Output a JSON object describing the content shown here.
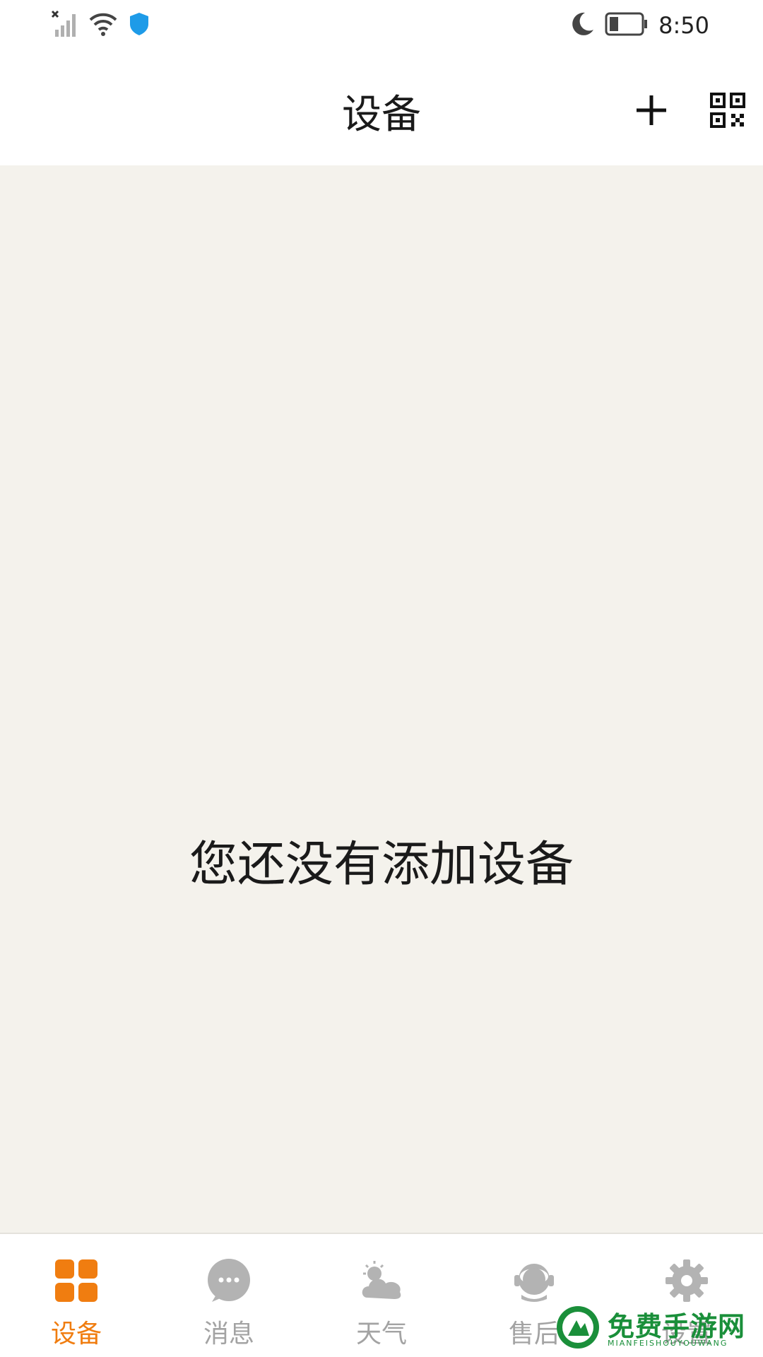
{
  "status_bar": {
    "time": "8:50",
    "icons": [
      "signal-off-icon",
      "wifi-icon",
      "shield-icon",
      "moon-icon",
      "battery-icon"
    ]
  },
  "header": {
    "title": "设备",
    "actions": [
      "add-icon",
      "qr-code-icon"
    ]
  },
  "main": {
    "empty_message": "您还没有添加设备"
  },
  "bottom_nav": {
    "items": [
      {
        "label": "设备",
        "icon": "devices-grid-icon",
        "active": true
      },
      {
        "label": "消息",
        "icon": "message-bubble-icon",
        "active": false
      },
      {
        "label": "天气",
        "icon": "weather-icon",
        "active": false
      },
      {
        "label": "售后",
        "icon": "support-headset-icon",
        "active": false
      },
      {
        "label": "设置",
        "icon": "gear-icon",
        "active": false
      }
    ]
  },
  "watermark": {
    "text": "免费手游网",
    "subtext": "MIANFEISHOUYOUWANG"
  },
  "colors": {
    "accent": "#f07d10",
    "inactive": "#a3a3a3",
    "background": "#f4f2ec",
    "watermark": "#1a8f3a"
  }
}
